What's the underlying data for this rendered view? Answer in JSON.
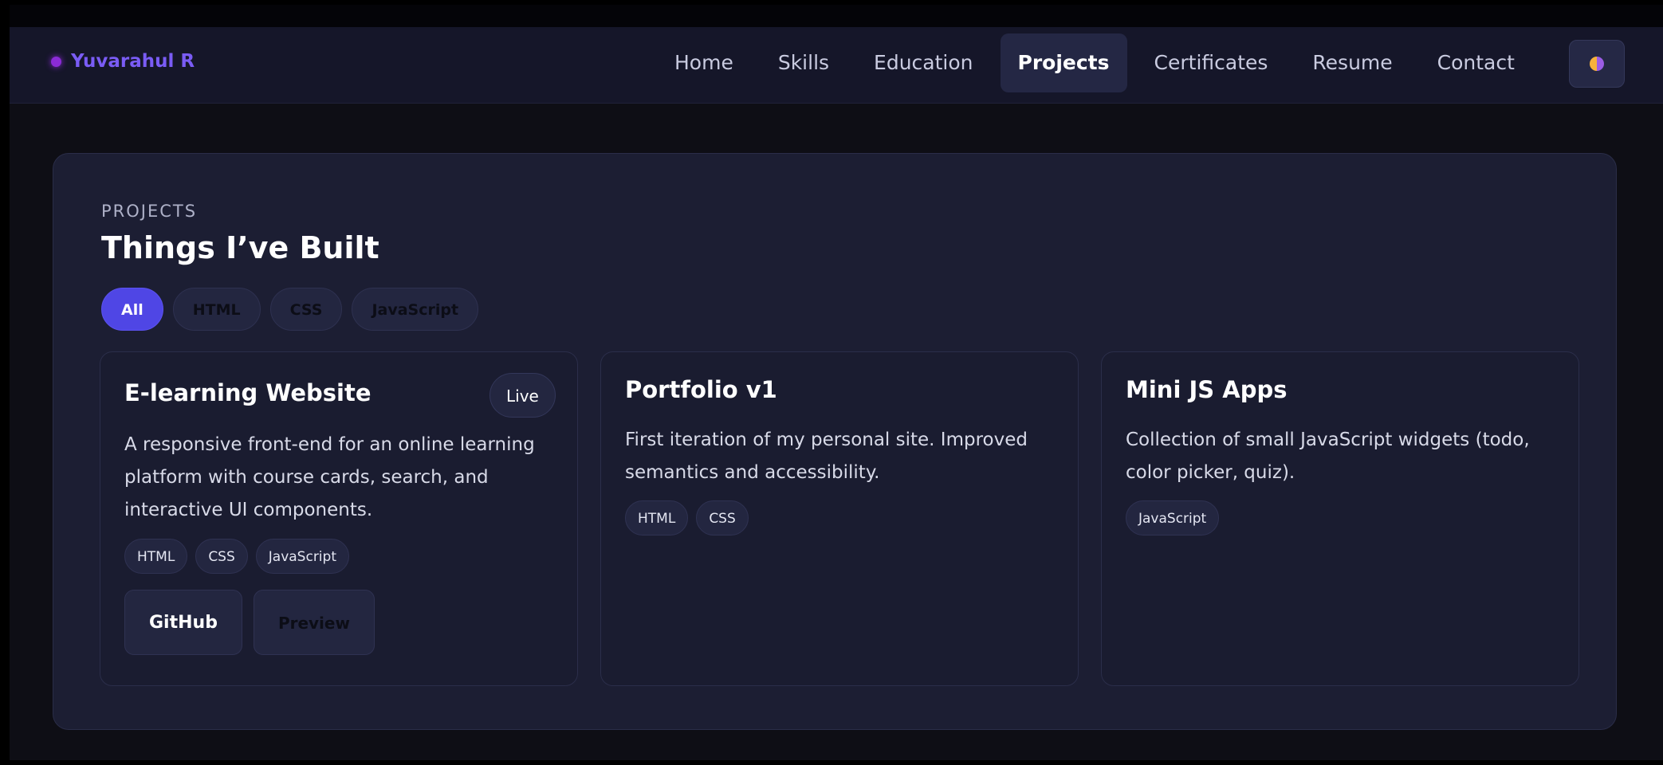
{
  "brand": {
    "name": "Yuvarahul R"
  },
  "nav": {
    "items": [
      {
        "label": "Home"
      },
      {
        "label": "Skills"
      },
      {
        "label": "Education"
      },
      {
        "label": "Projects",
        "active": true
      },
      {
        "label": "Certificates"
      },
      {
        "label": "Resume"
      },
      {
        "label": "Contact"
      }
    ],
    "theme_toggle_icon": "theme-toggle-icon"
  },
  "projects": {
    "eyebrow": "PROJECTS",
    "title": "Things I’ve Built",
    "filters": [
      {
        "label": "All",
        "active": true
      },
      {
        "label": "HTML"
      },
      {
        "label": "CSS"
      },
      {
        "label": "JavaScript"
      }
    ],
    "cards": [
      {
        "title": "E-learning Website",
        "badge": "Live",
        "description": "A responsive front-end for an online learning platform with course cards, search, and interactive UI components.",
        "tags": [
          "HTML",
          "CSS",
          "JavaScript"
        ],
        "actions": {
          "github": "GitHub",
          "preview": "Preview"
        }
      },
      {
        "title": "Portfolio v1",
        "description": "First iteration of my personal site. Improved semantics and accessibility.",
        "tags": [
          "HTML",
          "CSS"
        ]
      },
      {
        "title": "Mini JS Apps",
        "description": "Collection of small JavaScript widgets (todo, color picker, quiz).",
        "tags": [
          "JavaScript"
        ]
      }
    ]
  },
  "colors": {
    "accent": "#4f46e5",
    "brand": "#7a5cf5",
    "background": "#0e0e15",
    "panel": "#1c1e33"
  }
}
